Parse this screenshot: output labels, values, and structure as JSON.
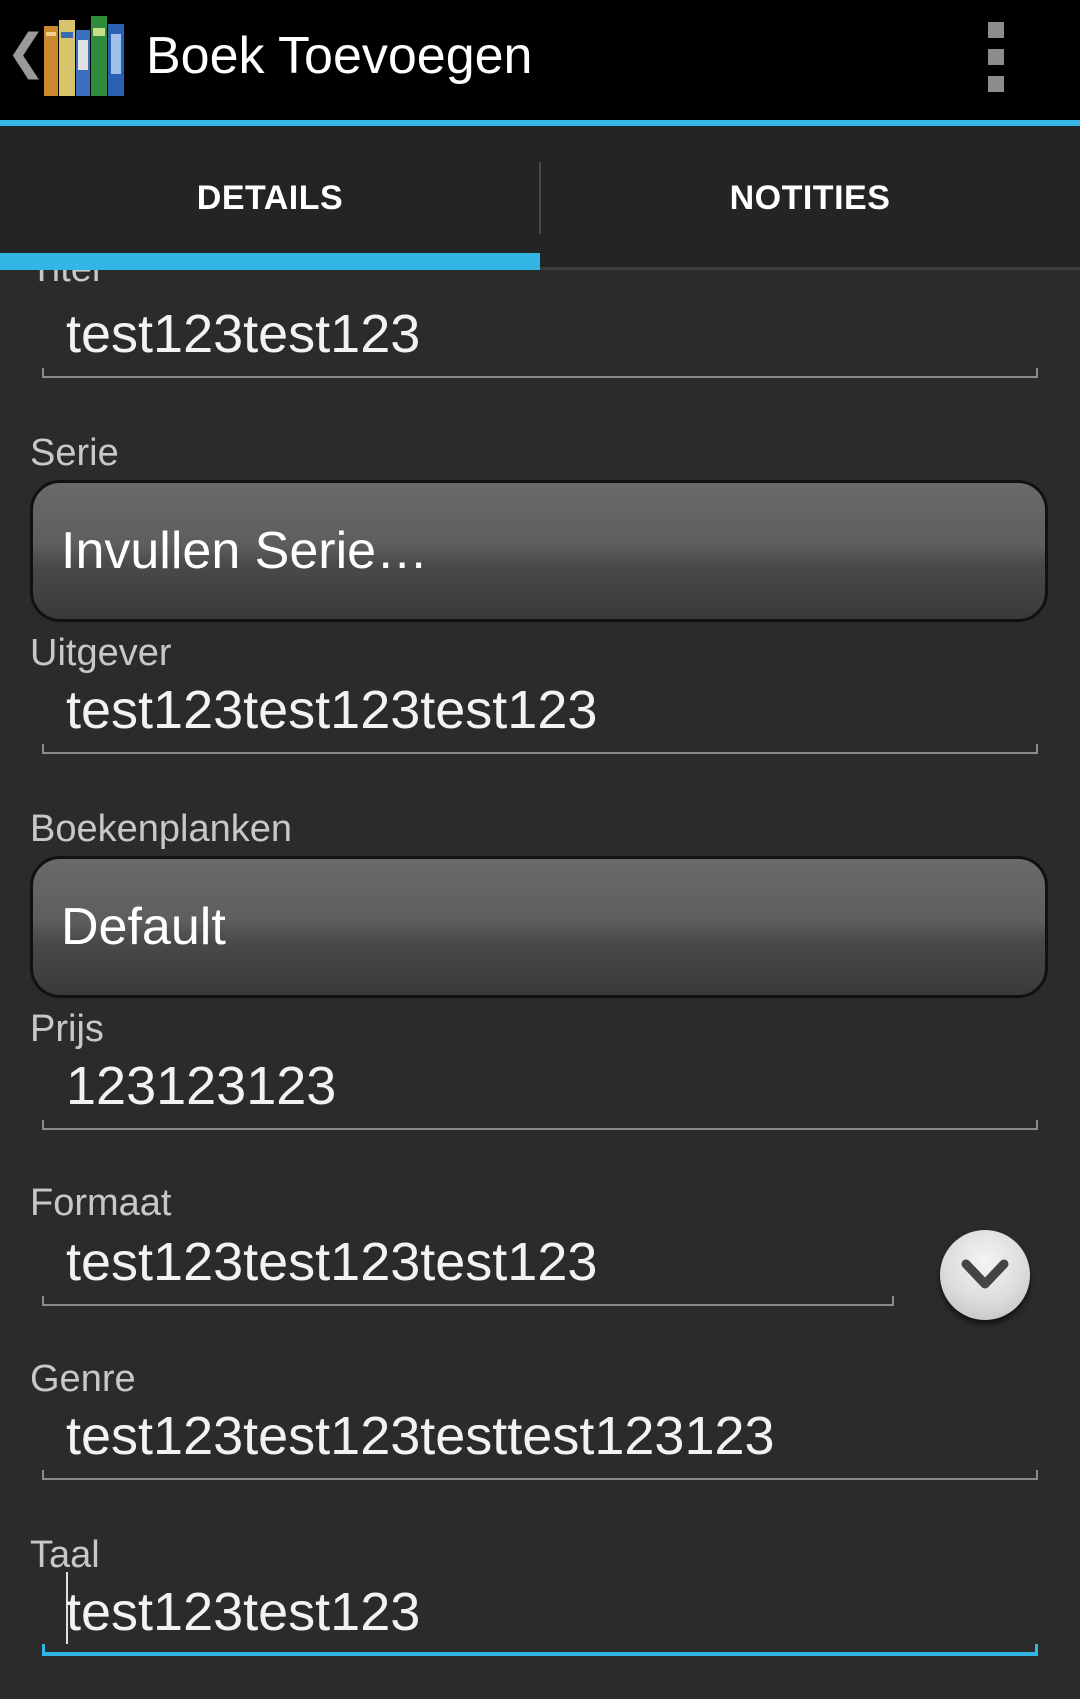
{
  "actionbar": {
    "title": "Boek Toevoegen",
    "back_icon": "chevron-left-icon",
    "app_icon": "books-icon",
    "menu_icon": "overflow-menu-icon"
  },
  "tabs": [
    {
      "label": "DETAILS",
      "selected": true
    },
    {
      "label": "NOTITIES",
      "selected": false
    }
  ],
  "form": {
    "titel": {
      "label": "Titel",
      "value": "test123test123"
    },
    "serie": {
      "label": "Serie",
      "button": "Invullen Serie…"
    },
    "uitgever": {
      "label": "Uitgever",
      "value": "test123test123test123"
    },
    "boekenplanken": {
      "label": "Boekenplanken",
      "button": "Default"
    },
    "prijs": {
      "label": "Prijs",
      "value": "123123123"
    },
    "formaat": {
      "label": "Formaat",
      "value": "test123test123test123"
    },
    "genre": {
      "label": "Genre",
      "value": "test123test123testtest123123"
    },
    "taal": {
      "label": "Taal",
      "value": "test123test123"
    }
  },
  "colors": {
    "accent": "#33b5e5",
    "background": "#2b2b2b"
  }
}
